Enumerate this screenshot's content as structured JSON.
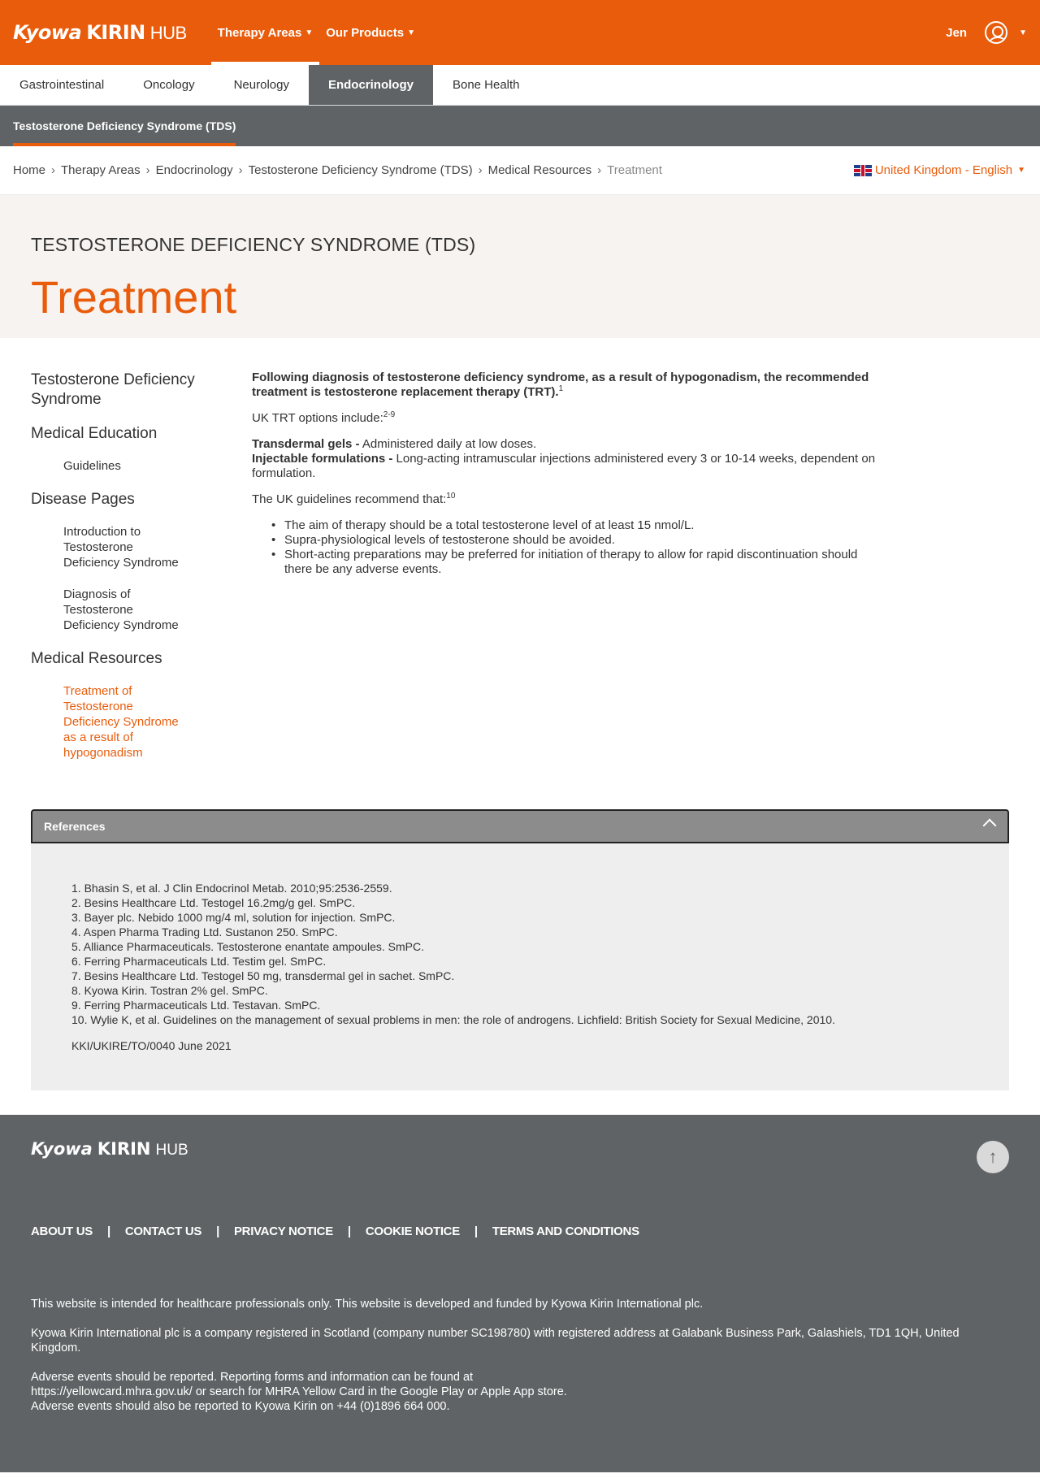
{
  "header": {
    "logo_kyowa": "Kyowa",
    "logo_kirin": "KIRIN",
    "logo_hub": "HUB",
    "nav": [
      {
        "label": "Therapy Areas"
      },
      {
        "label": "Our Products"
      }
    ],
    "user_name": "Jen"
  },
  "tabs": [
    "Gastrointestinal",
    "Oncology",
    "Neurology",
    "Endocrinology",
    "Bone Health"
  ],
  "subnav": {
    "label": "Testosterone Deficiency Syndrome (TDS)"
  },
  "breadcrumb": [
    "Home",
    "Therapy Areas",
    "Endocrinology",
    "Testosterone Deficiency Syndrome (TDS)",
    "Medical Resources",
    "Treatment"
  ],
  "locale": {
    "label": "United Kingdom - English"
  },
  "hero": {
    "kicker": "TESTOSTERONE DEFICIENCY SYNDROME (TDS)",
    "title": "Treatment"
  },
  "sidebar": {
    "sections": [
      {
        "label": "Testosterone Deficiency Syndrome"
      },
      {
        "label": "Medical Education"
      },
      {
        "label": "Guidelines"
      },
      {
        "label": "Disease Pages"
      },
      {
        "label": "Introduction to Testosterone Deficiency Syndrome"
      },
      {
        "label": "Diagnosis of Testosterone Deficiency Syndrome"
      },
      {
        "label": "Medical Resources"
      },
      {
        "label": "Treatment of Testosterone Deficiency Syndrome as a result of hypogonadism"
      }
    ]
  },
  "content": {
    "intro": "Following diagnosis of testosterone deficiency syndrome, as a result of hypogonadism, the recommended treatment is testosterone replacement therapy (TRT).",
    "intro_sup": "1",
    "options_label": "UK TRT options include:",
    "options_sup": "2-9",
    "gels_title": "Transdermal gels -",
    "gels_text": " Administered daily at low doses.",
    "inj_title": "Injectable formulations -",
    "inj_text": " Long-acting intramuscular injections administered every 3 or 10-14 weeks, dependent on formulation.",
    "guide_label": "The UK guidelines recommend that:",
    "guide_sup": "10",
    "bullets": [
      "The aim of therapy should be a total testosterone level of at least 15 nmol/L.",
      "Supra-physiological levels of testosterone should be avoided.",
      "Short-acting preparations may be preferred for initiation of therapy to allow for rapid discontinuation should there be any adverse events."
    ]
  },
  "references": {
    "title": "References",
    "items": [
      "1. Bhasin S, et al. J Clin Endocrinol Metab. 2010;95:2536-2559.",
      "2. Besins Healthcare Ltd. Testogel 16.2mg/g gel. SmPC.",
      "3. Bayer plc. Nebido 1000 mg/4 ml, solution for injection. SmPC.",
      "4. Aspen Pharma Trading Ltd. Sustanon 250. SmPC.",
      "5. Alliance Pharmaceuticals. Testosterone enantate ampoules. SmPC.",
      "6. Ferring Pharmaceuticals Ltd. Testim gel. SmPC.",
      "7. Besins Healthcare Ltd. Testogel 50 mg, transdermal gel in sachet. SmPC.",
      "8. Kyowa Kirin. Tostran 2% gel. SmPC.",
      "9. Ferring Pharmaceuticals Ltd. Testavan. SmPC.",
      "10. Wylie K, et al. Guidelines on the management of sexual problems in men: the role of androgens. Lichfield: British Society for Sexual Medicine, 2010."
    ],
    "code": "KKI/UKIRE/TO/0040 June 2021"
  },
  "footer": {
    "links": [
      "ABOUT US",
      "CONTACT US",
      "PRIVACY NOTICE",
      "COOKIE NOTICE",
      "TERMS AND CONDITIONS"
    ],
    "text1": "This website is intended for healthcare professionals only. This website is developed and funded by Kyowa Kirin International plc.",
    "text2": "Kyowa Kirin International plc is a company registered in Scotland (company number SC198780) with registered address at Galabank Business Park, Galashiels, TD1 1QH, United Kingdom.",
    "text3a": "Adverse events should be reported. Reporting forms and information can be found at",
    "text3b": "https://yellowcard.mhra.gov.uk/ or search for MHRA Yellow Card in the Google Play or Apple App store.",
    "text3c": "Adverse events should also be reported to Kyowa Kirin on +44 (0)1896 664 000."
  },
  "colors": {
    "brand_orange": "#e95c0c",
    "dark_grey": "#5f6365"
  }
}
